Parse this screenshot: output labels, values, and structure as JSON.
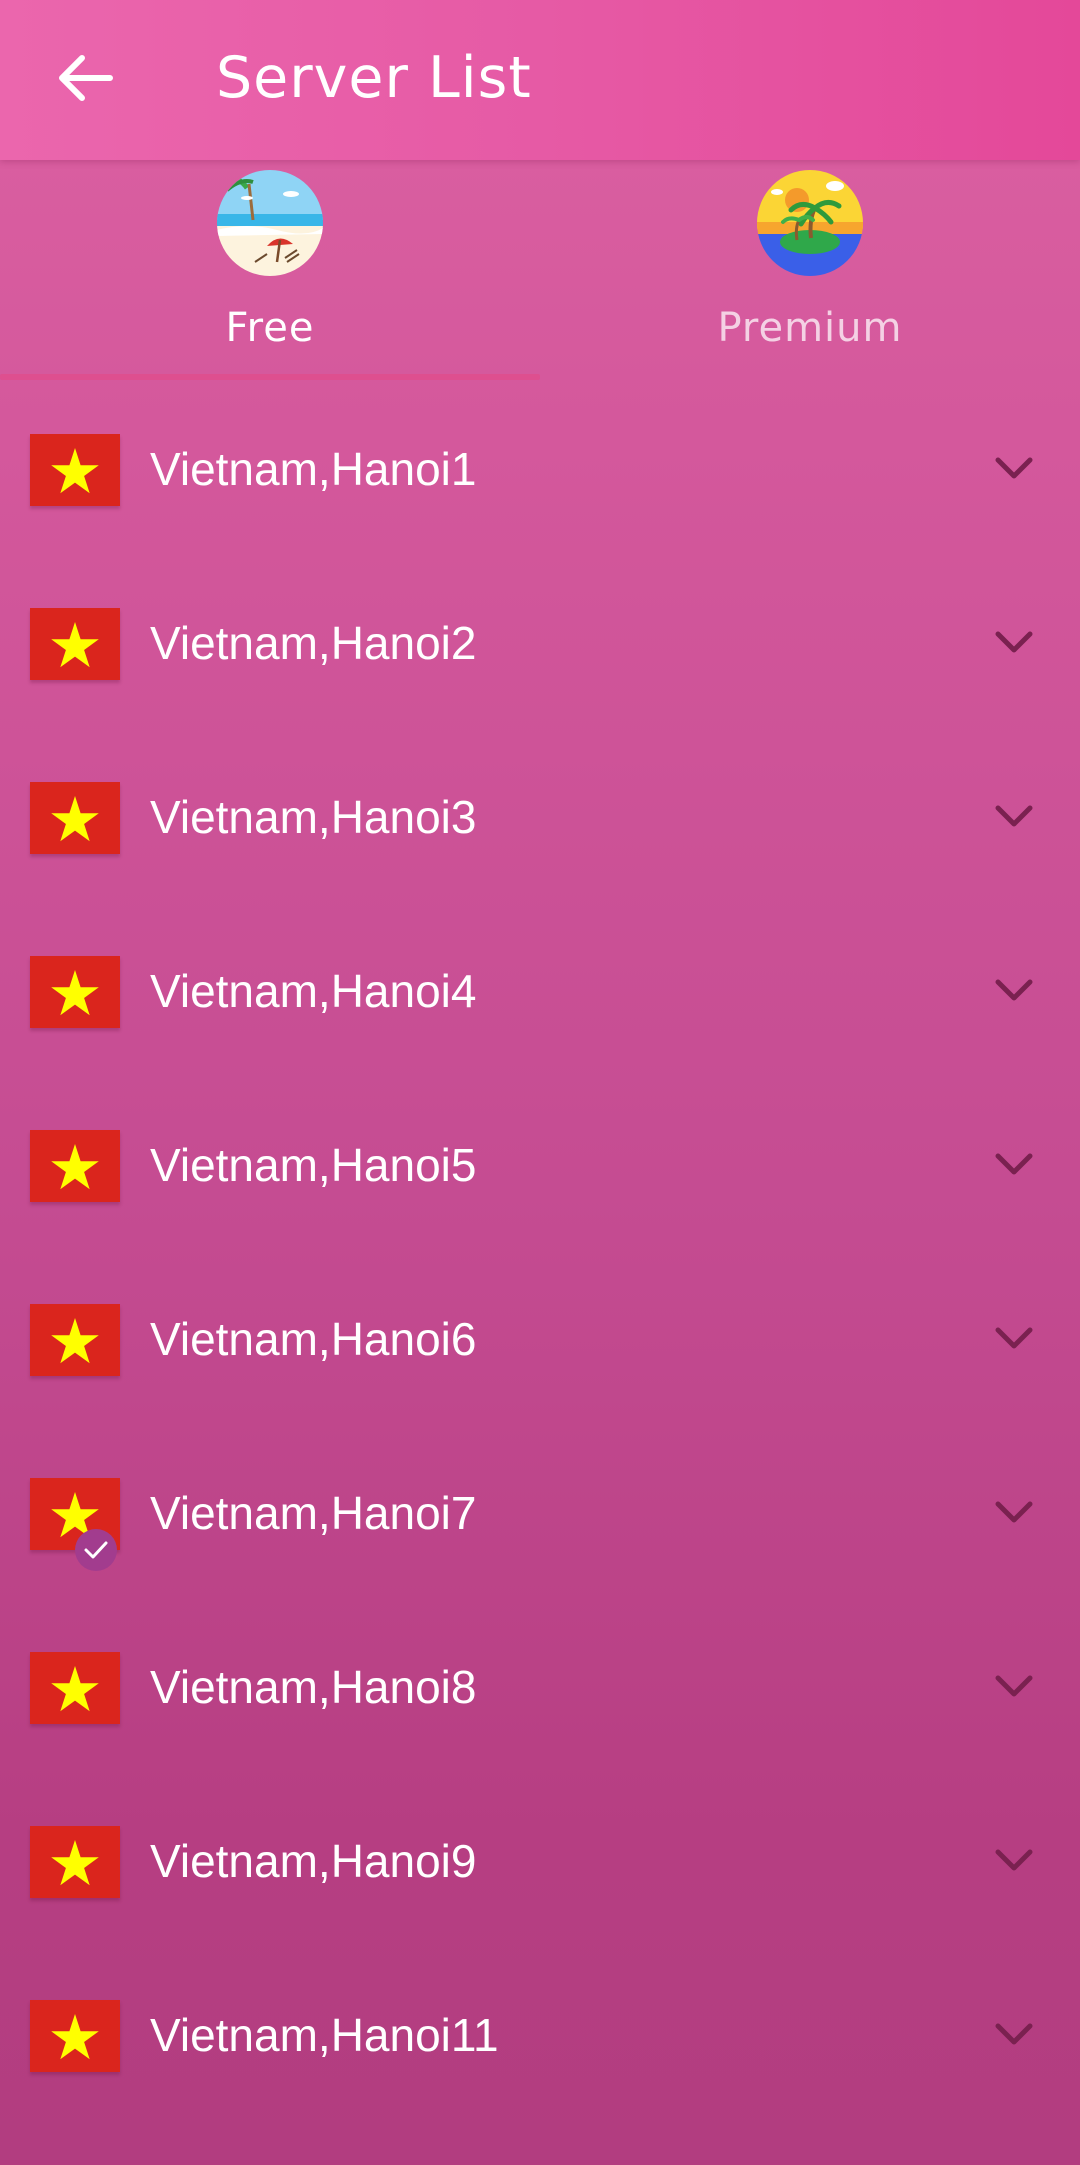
{
  "header": {
    "back_icon": "arrow-left-icon",
    "title": "Server List"
  },
  "tabs": [
    {
      "label": "Free",
      "icon": "beach-umbrella-icon",
      "selected": true
    },
    {
      "label": "Premium",
      "icon": "palm-island-icon",
      "selected": false
    }
  ],
  "servers": [
    {
      "name": "Vietnam,Hanoi1",
      "flag": "vietnam-flag-icon",
      "selected": false
    },
    {
      "name": "Vietnam,Hanoi2",
      "flag": "vietnam-flag-icon",
      "selected": false
    },
    {
      "name": "Vietnam,Hanoi3",
      "flag": "vietnam-flag-icon",
      "selected": false
    },
    {
      "name": "Vietnam,Hanoi4",
      "flag": "vietnam-flag-icon",
      "selected": false
    },
    {
      "name": "Vietnam,Hanoi5",
      "flag": "vietnam-flag-icon",
      "selected": false
    },
    {
      "name": "Vietnam,Hanoi6",
      "flag": "vietnam-flag-icon",
      "selected": false
    },
    {
      "name": "Vietnam,Hanoi7",
      "flag": "vietnam-flag-icon",
      "selected": true
    },
    {
      "name": "Vietnam,Hanoi8",
      "flag": "vietnam-flag-icon",
      "selected": false
    },
    {
      "name": "Vietnam,Hanoi9",
      "flag": "vietnam-flag-icon",
      "selected": false
    },
    {
      "name": "Vietnam,Hanoi11",
      "flag": "vietnam-flag-icon",
      "selected": false
    }
  ],
  "colors": {
    "header_start": "#eb66ad",
    "header_end": "#e44899",
    "background_top": "#dc61a2",
    "background_bottom": "#b23d80",
    "tab_indicator": "#de4f8f",
    "flag_red": "#da251d",
    "flag_star": "#ffff00",
    "chevron": "#7a2150",
    "check_badge": "#a23c8e"
  }
}
